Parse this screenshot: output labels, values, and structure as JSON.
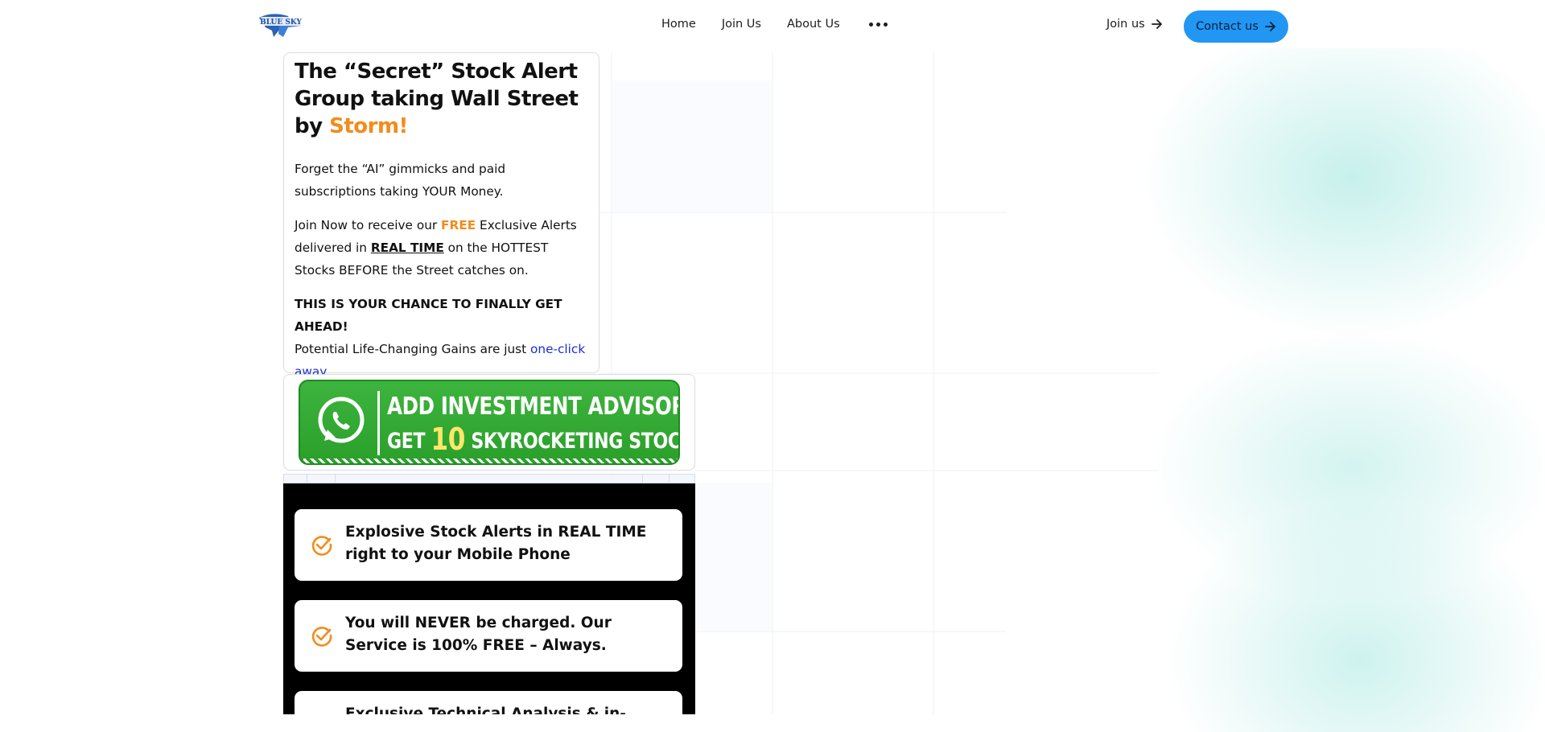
{
  "nav": {
    "logo_text": "BLUE SKY",
    "links": [
      "Home",
      "Join Us",
      "About Us"
    ],
    "join_label": "Join us",
    "contact_label": "Contact us"
  },
  "hero": {
    "title_part1": "The “Secret” Stock Alert Group taking Wall Street by ",
    "title_accent": "Storm!",
    "p1": "Forget the “AI” gimmicks and paid subscriptions taking YOUR Money.",
    "p2_a": "Join Now to receive our ",
    "p2_free": "FREE",
    "p2_b": " Exclusive Alerts delivered in ",
    "p2_realtime": "REAL TIME",
    "p2_c": " on the HOTTEST Stocks BEFORE the Street catches on.",
    "p3_bold": "THIS IS YOUR CHANCE TO FINALLY GET AHEAD!",
    "p3_a": "Potential Life-Changing Gains are just ",
    "p3_link": "one-click away",
    "p3_end": ".."
  },
  "banner": {
    "line1": "ADD INVESTMENT ADVISOR",
    "line2_a": "GET ",
    "line2_num": "10",
    "line2_b": " SKYROCKETING STOCKS"
  },
  "features": [
    "Explosive Stock Alerts in REAL TIME right to your Mobile Phone",
    "You will NEVER be charged. Our Service is 100% FREE – Always.",
    "Exclusive Technical Analysis & in-depth"
  ],
  "colors": {
    "accent_orange": "#f28c1b",
    "contact_blue": "#2196f3",
    "link_blue": "#1e2bd6",
    "banner_green": "#2aa02a"
  }
}
